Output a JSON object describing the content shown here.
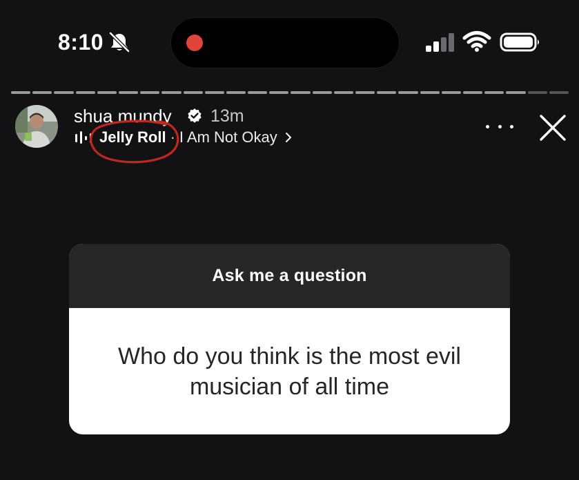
{
  "status_bar": {
    "time": "8:10",
    "icons": [
      "bell-off-icon",
      "cellular-signal-icon",
      "wifi-icon",
      "battery-icon"
    ],
    "recording_indicator_color": "#e0443a"
  },
  "story": {
    "progress_segments_total": 26,
    "progress_segments_viewed": 24,
    "header": {
      "username": "shua mundy",
      "verified": true,
      "time_ago": "13m",
      "music": {
        "artist": "Jelly Roll",
        "separator": "·",
        "song": "I Am Not Okay"
      },
      "annotation_color": "#c0281e"
    },
    "question_card": {
      "prompt": "Ask me a question",
      "question": "Who do you think is the most evil musician of all time"
    }
  },
  "colors": {
    "background": "#121214",
    "card_header": "#262628",
    "card_body": "#ffffff",
    "card_text": "#262628"
  }
}
